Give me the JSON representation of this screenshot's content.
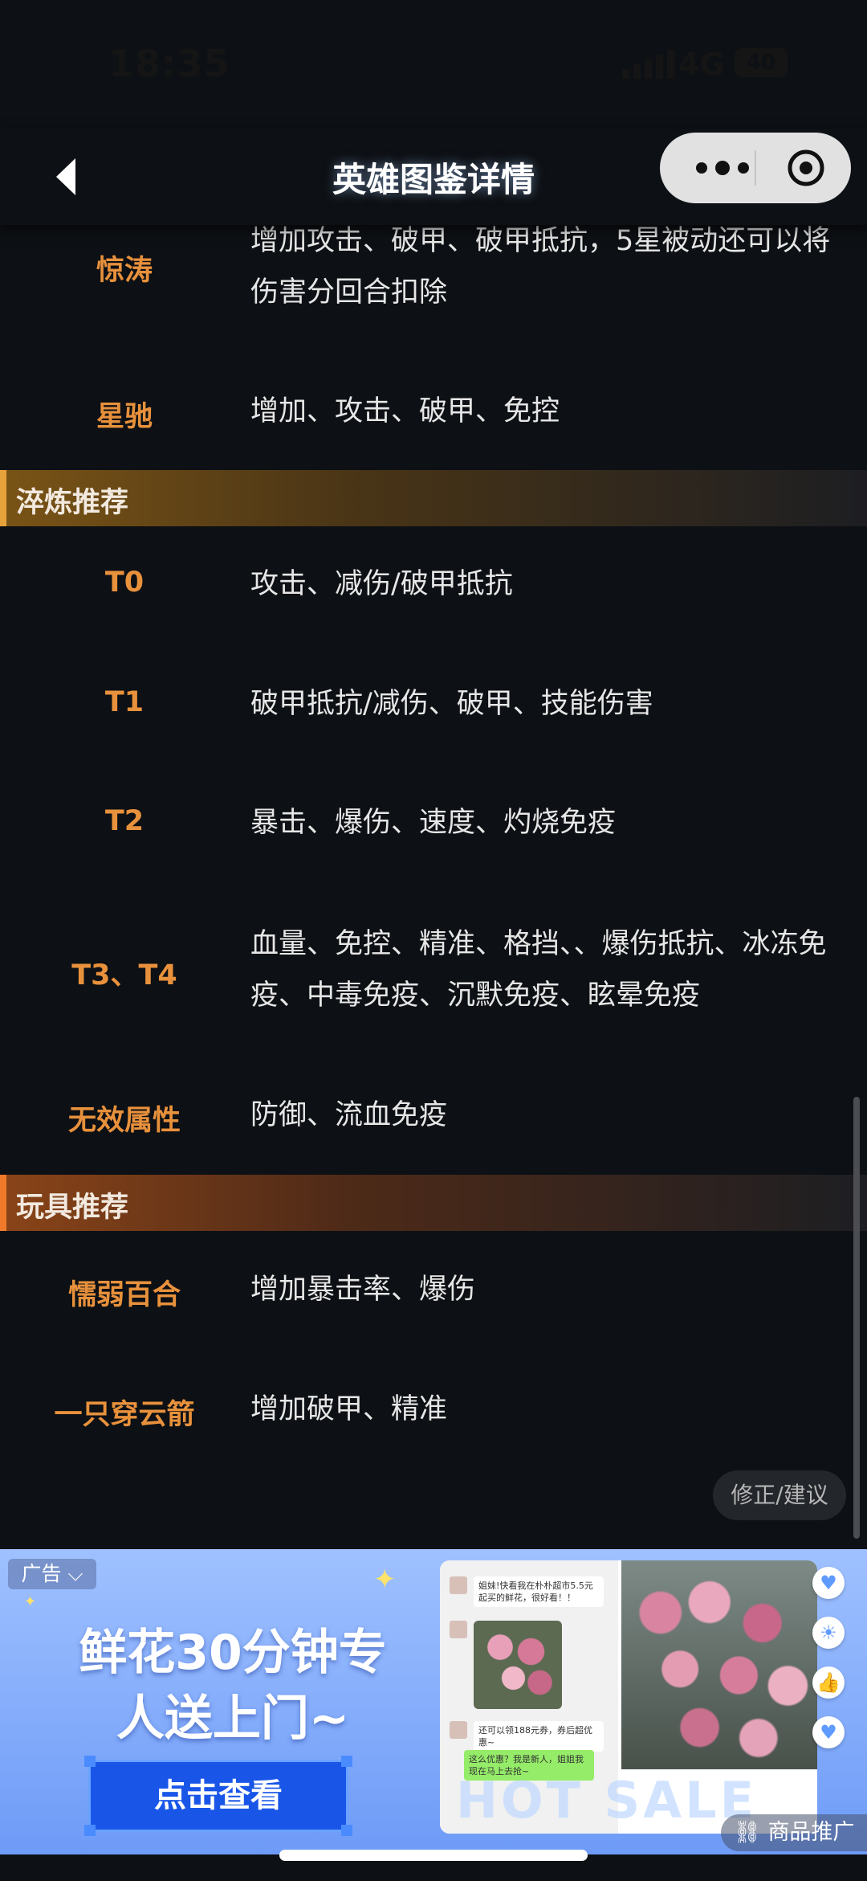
{
  "status": {
    "time": "18:35",
    "network": "4G",
    "battery": "40"
  },
  "nav": {
    "title": "英雄图鉴详情"
  },
  "top_rows": [
    {
      "key": "惊涛",
      "value": "增加攻击、破甲、破甲抵抗，5星被动还可以将伤害分回合扣除"
    },
    {
      "key": "星驰",
      "value": "增加、攻击、破甲、免控"
    }
  ],
  "sections": [
    {
      "title": "淬炼推荐",
      "rows": [
        {
          "key": "T0",
          "value": "攻击、减伤/破甲抵抗"
        },
        {
          "key": "T1",
          "value": "破甲抵抗/减伤、破甲、技能伤害"
        },
        {
          "key": "T2",
          "value": "暴击、爆伤、速度、灼烧免疫"
        },
        {
          "key": "T3、T4",
          "value": "血量、免控、精准、格挡、、爆伤抵抗、冰冻免疫、中毒免疫、沉默免疫、眩晕免疫"
        },
        {
          "key": "无效属性",
          "value": "防御、流血免疫"
        }
      ]
    },
    {
      "title": "玩具推荐",
      "rows": [
        {
          "key": "懦弱百合",
          "value": "增加暴击率、爆伤"
        },
        {
          "key": "一只穿云箭",
          "value": "增加破甲、精准"
        }
      ]
    }
  ],
  "fix_button": "修正/建议",
  "ad": {
    "tag": "广告",
    "headline_1": "鲜花30分钟专",
    "headline_2": "人送上门~",
    "cta": "点击查看",
    "chat_1": "姐妹!快看我在朴朴超市5.5元起买的鲜花，很好看！！",
    "chat_2": "还可以领188元券，券后超优惠~",
    "chat_3": "这么优惠？我是新人，姐姐我现在马上去抢~",
    "overlay_text": "HOT SALE",
    "promo_label": "商品推广"
  },
  "icons": {
    "back": "back-arrow-icon",
    "more": "more-dots-icon",
    "close": "target-icon"
  }
}
